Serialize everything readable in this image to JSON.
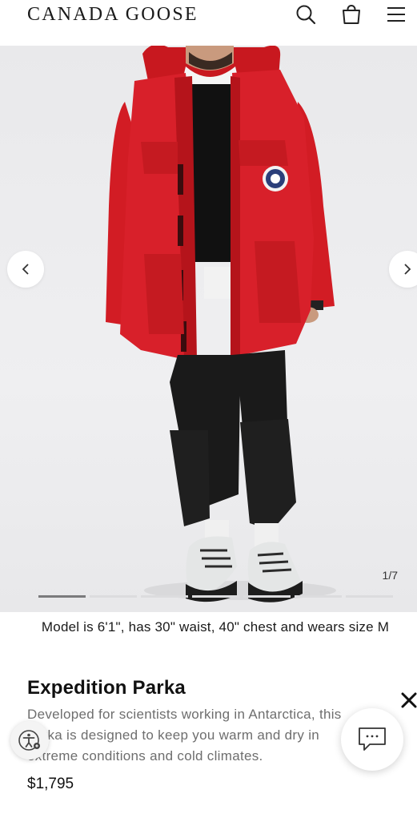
{
  "header": {
    "brand": "CANADA GOOSE",
    "icons": [
      "search-icon",
      "bag-icon",
      "menu-icon"
    ]
  },
  "gallery": {
    "counter": "1/7",
    "slide_index": 1,
    "slide_total": 7,
    "prev_icon": "chevron-left-icon",
    "next_icon": "chevron-right-icon"
  },
  "caption": "Model is 6'1\", has 30\" waist, 40\" chest and wears size M",
  "product": {
    "title": "Expedition Parka",
    "description": "Developed for scientists working in Antarctica, this parka is designed to keep you warm and dry in extreme conditions and cold climates.",
    "price": "$1,795"
  },
  "widgets": {
    "close_icon": "close-icon",
    "chat_icon": "chat-bubble-icon",
    "accessibility_icon": "accessibility-icon"
  },
  "colors": {
    "parka_red": "#d8202a",
    "text": "#111111",
    "muted_text": "#6e6e6e"
  }
}
